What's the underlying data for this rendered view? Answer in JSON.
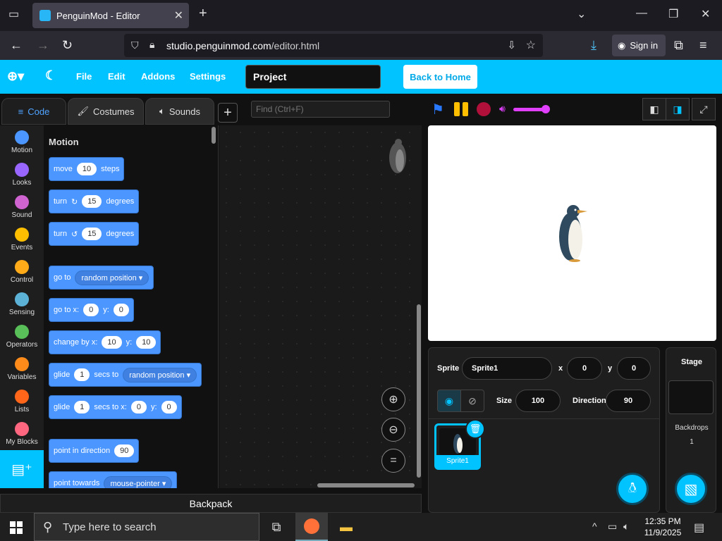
{
  "browser": {
    "tab_title": "PenguinMod - Editor",
    "url_host": "studio.penguinmod.com",
    "url_path": "/editor.html",
    "sign_in": "Sign in"
  },
  "menu": {
    "file": "File",
    "edit": "Edit",
    "addons": "Addons",
    "settings": "Settings",
    "project_title": "Project",
    "back_home": "Back to Home"
  },
  "editor": {
    "tabs": [
      "Code",
      "Costumes",
      "Sounds"
    ],
    "find_placeholder": "Find (Ctrl+F)",
    "categories": [
      {
        "label": "Motion",
        "color": "#4c97ff"
      },
      {
        "label": "Looks",
        "color": "#9966ff"
      },
      {
        "label": "Sound",
        "color": "#cf63cf"
      },
      {
        "label": "Events",
        "color": "#ffbf00"
      },
      {
        "label": "Control",
        "color": "#ffab19"
      },
      {
        "label": "Sensing",
        "color": "#5cb1d6"
      },
      {
        "label": "Operators",
        "color": "#59c059"
      },
      {
        "label": "Variables",
        "color": "#ff8c1a"
      },
      {
        "label": "Lists",
        "color": "#ff661a"
      },
      {
        "label": "My Blocks",
        "color": "#ff6680"
      }
    ],
    "palette_title": "Motion",
    "blocks": {
      "move": {
        "pre": "move",
        "val": "10",
        "post": "steps"
      },
      "turn_right": {
        "pre": "turn",
        "val": "15",
        "post": "degrees"
      },
      "turn_left": {
        "pre": "turn",
        "val": "15",
        "post": "degrees"
      },
      "go_to": {
        "pre": "go to",
        "drop": "random position"
      },
      "go_to_xy": {
        "pre": "go to x:",
        "x": "0",
        "mid": "y:",
        "y": "0"
      },
      "change_by": {
        "pre": "change by x:",
        "x": "10",
        "mid": "y:",
        "y": "10"
      },
      "glide_to": {
        "pre": "glide",
        "val": "1",
        "mid": "secs to",
        "drop": "random position"
      },
      "glide_xy": {
        "pre": "glide",
        "val": "1",
        "mid": "secs to x:",
        "x": "0",
        "mid2": "y:",
        "y": "0"
      },
      "point_dir": {
        "pre": "point in direction",
        "val": "90"
      },
      "point_towards": {
        "pre": "point towards",
        "drop": "mouse-pointer"
      }
    },
    "backpack": "Backpack"
  },
  "sprite_info": {
    "sprite_label": "Sprite",
    "sprite_name": "Sprite1",
    "x_label": "x",
    "x": "0",
    "y_label": "y",
    "y": "0",
    "size_label": "Size",
    "size": "100",
    "direction_label": "Direction",
    "direction": "90",
    "thumb_name": "Sprite1"
  },
  "stage_panel": {
    "title": "Stage",
    "backdrops_label": "Backdrops",
    "backdrops_count": "1"
  },
  "taskbar": {
    "search_placeholder": "Type here to search",
    "time": "12:35 PM",
    "date": "11/9/2025"
  },
  "colors": {
    "accent": "#00c3ff",
    "motion": "#4c97ff"
  }
}
